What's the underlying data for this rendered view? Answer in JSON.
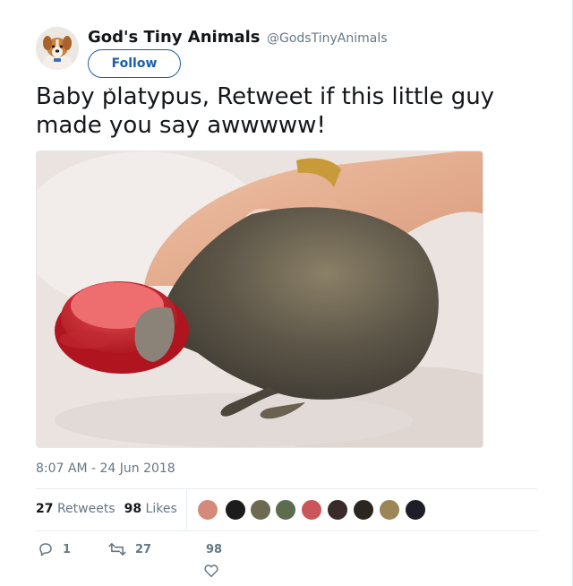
{
  "author": {
    "display_name": "God's Tiny Animals",
    "handle": "@GodsTinyAnimals",
    "avatar_icon": "puppy-avatar"
  },
  "follow_label": "Follow",
  "tweet": {
    "text": "Baby platypus, Retweet if this little guy made you say awwwww!",
    "caret": "ˇ",
    "timestamp": "8:07 AM - 24 Jun 2018"
  },
  "stats": {
    "retweets_count": "27",
    "retweets_label": "Retweets",
    "likes_count": "98",
    "likes_label": "Likes"
  },
  "liker_avatars": [
    "liker-1",
    "liker-2",
    "liker-3",
    "liker-4",
    "liker-5",
    "liker-6",
    "liker-7",
    "liker-8",
    "liker-9"
  ],
  "actions": {
    "reply_count": "1",
    "retweet_count": "27",
    "like_count": "98"
  },
  "colors": {
    "accent": "#1b5ea8",
    "muted": "#657786",
    "text": "#14171a",
    "border": "#e6ecf0"
  }
}
